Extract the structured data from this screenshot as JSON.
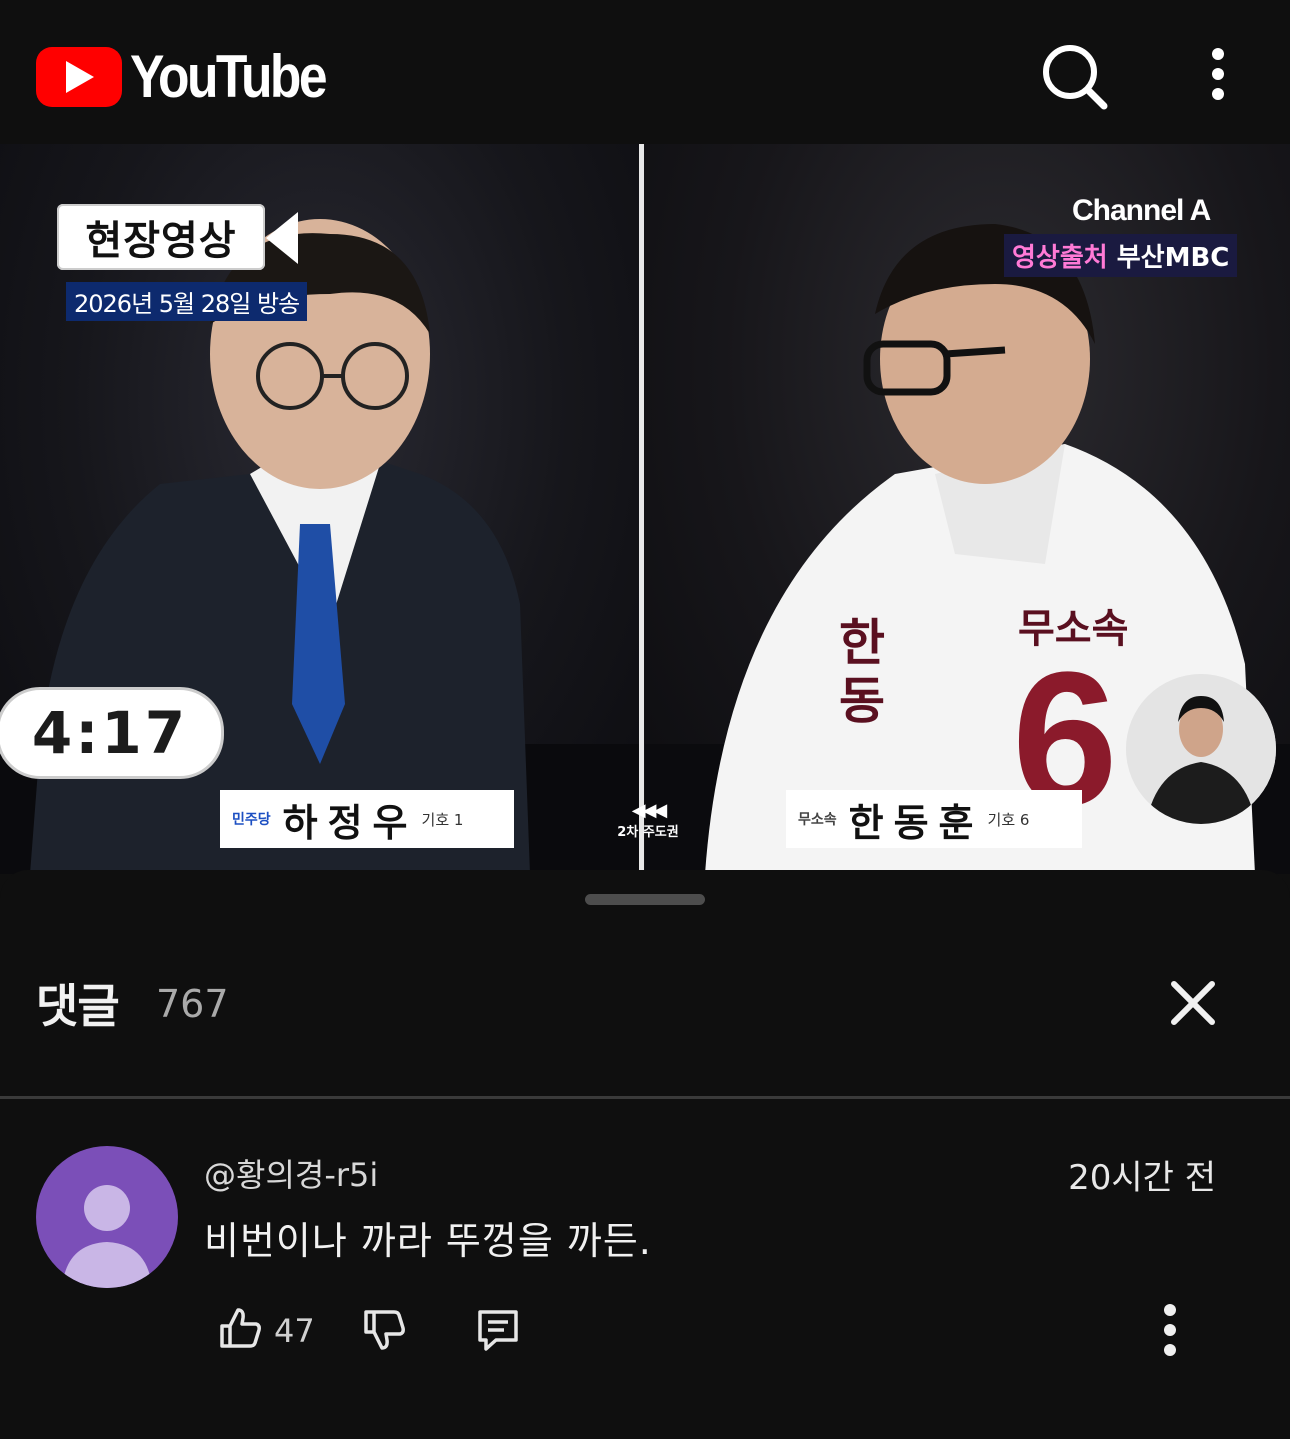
{
  "app": {
    "brand": "YouTube",
    "brand_color": "#ff0000",
    "icons": {
      "search": "search-icon",
      "more": "more-vert-icon"
    }
  },
  "video": {
    "badge": "현장영상",
    "date": "2026년 5월 28일 방송",
    "channel": "Channel A",
    "source_prefix": "영상출처",
    "source": "부산MBC",
    "timer": "4:17",
    "round": "2차 주도권",
    "left_candidate": {
      "party": "민주당",
      "name": "하정우",
      "number": "기호 1"
    },
    "right_candidate": {
      "party": "무소속",
      "name": "한동훈",
      "number": "기호 6"
    },
    "sash_text": "한 동",
    "sash_party": "무소속",
    "sash_number": "6"
  },
  "comments_sheet": {
    "title": "댓글",
    "count": "767",
    "close_icon": "close-icon"
  },
  "comment": {
    "author": "@황의경-r5i",
    "time": "20시간 전",
    "text": "비번이나 까라 뚜껑을 까든.",
    "likes": "47",
    "avatar_color": "#7b4fb8"
  }
}
